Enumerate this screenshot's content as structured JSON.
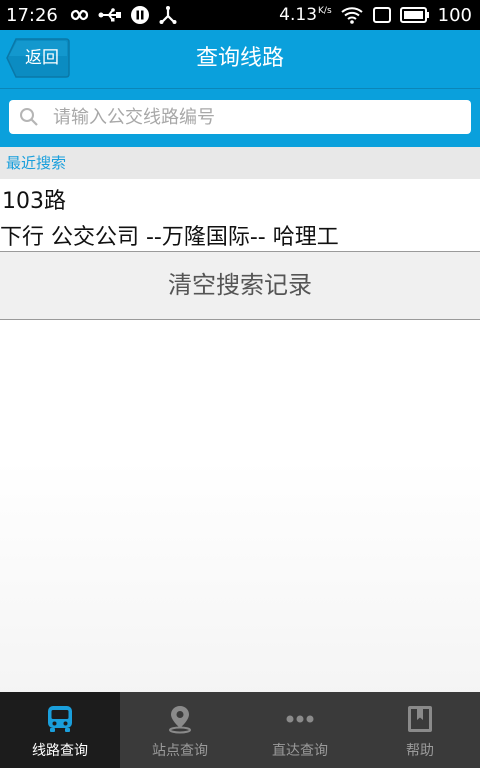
{
  "status_bar": {
    "time": "17:26",
    "network_speed": "4.13",
    "network_speed_unit": "K/s",
    "battery": "100"
  },
  "header": {
    "back_label": "返回",
    "title": "查询线路"
  },
  "search": {
    "placeholder": "请输入公交线路编号",
    "value": ""
  },
  "recent": {
    "header": "最近搜索",
    "items": [
      {
        "route": "103路",
        "detail": "下行 公交公司 --万隆国际-- 哈理工"
      }
    ],
    "clear_label": "清空搜索记录"
  },
  "tabs": [
    {
      "label": "线路查询",
      "icon": "bus-icon",
      "active": true
    },
    {
      "label": "站点查询",
      "icon": "location-pin-icon",
      "active": false
    },
    {
      "label": "直达查询",
      "icon": "more-dots-icon",
      "active": false
    },
    {
      "label": "帮助",
      "icon": "help-book-icon",
      "active": false
    }
  ],
  "colors": {
    "accent": "#0aa0dc",
    "tab_active_icon": "#1a9fdc",
    "tab_inactive_icon": "#8a8a8a"
  }
}
